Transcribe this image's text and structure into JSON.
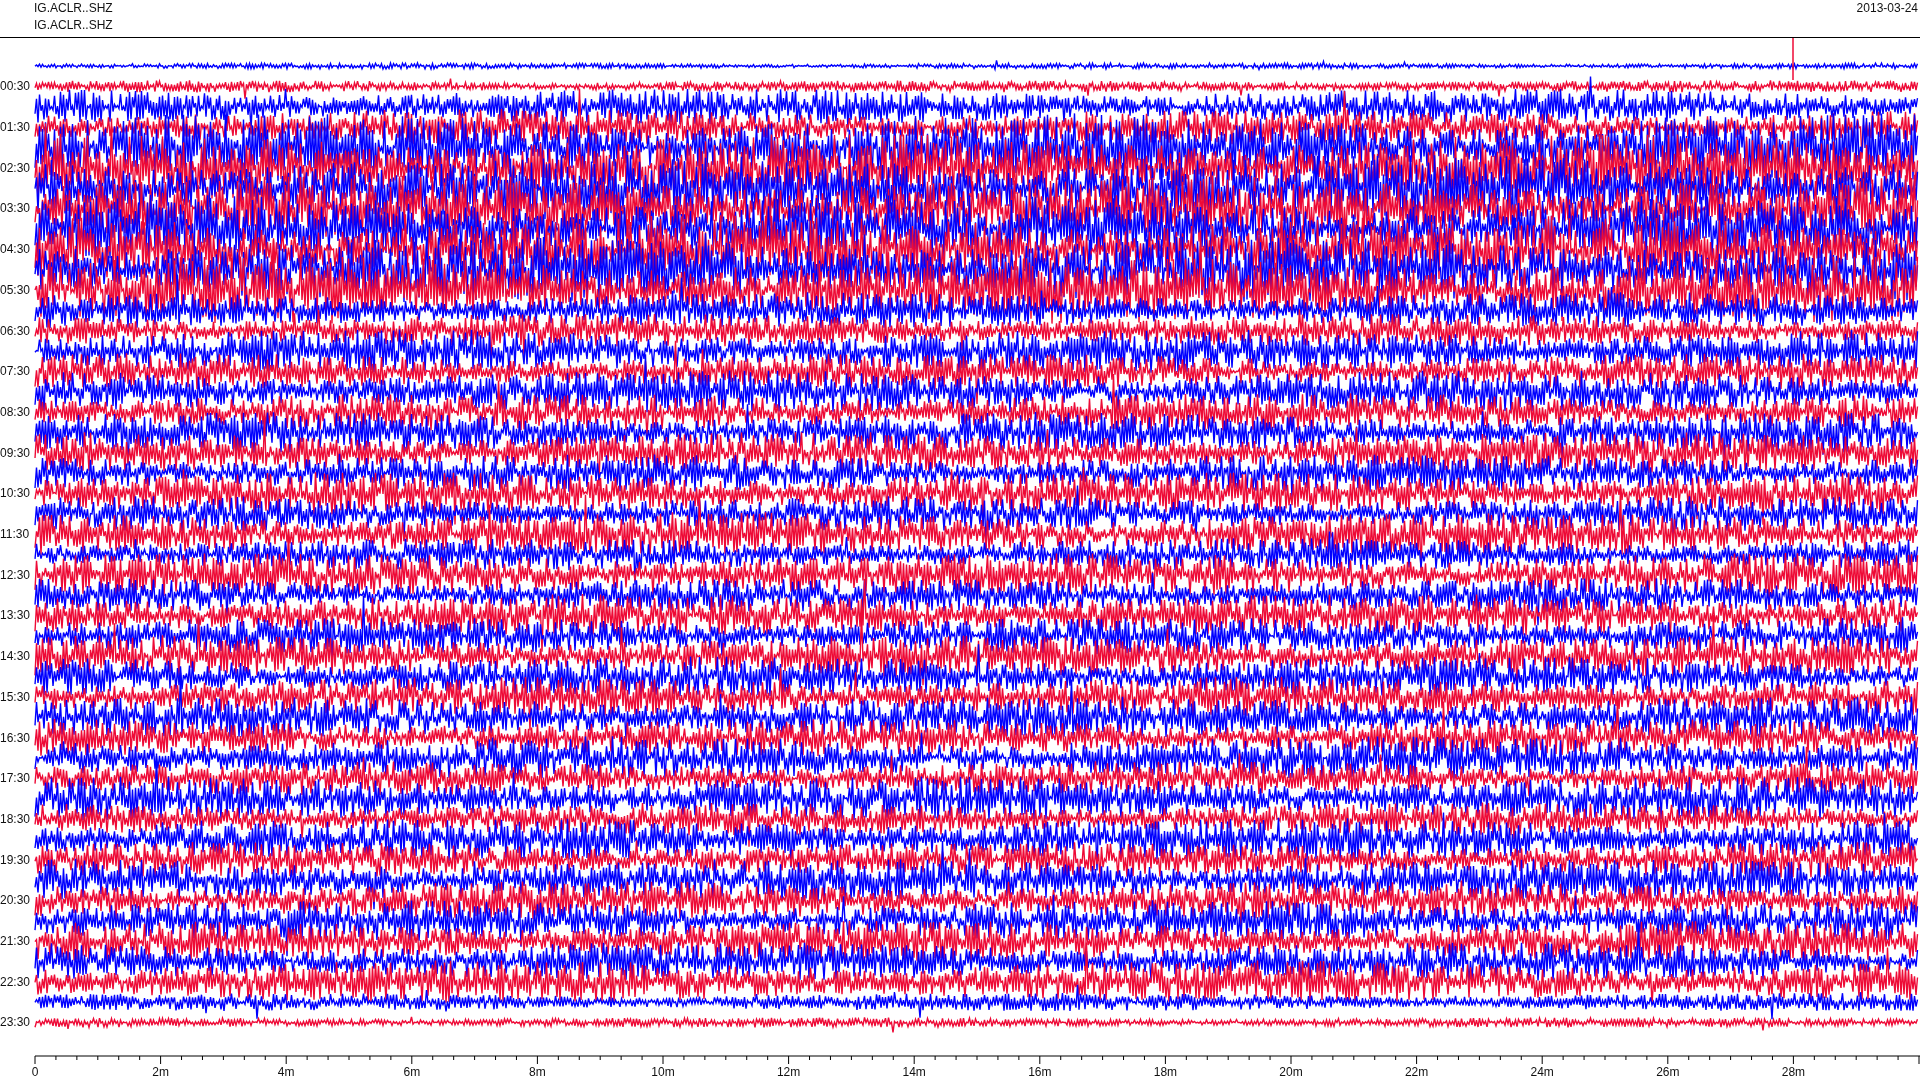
{
  "header": {
    "station_lines": [
      "IG.ACLR..SHZ",
      "IG.ACLR..SHZ"
    ],
    "date": "2013-03-24"
  },
  "helicorder": {
    "row_labels": [
      "00:30",
      "01:30",
      "02:30",
      "03:30",
      "04:30",
      "05:30",
      "06:30",
      "07:30",
      "08:30",
      "09:30",
      "10:30",
      "11:30",
      "12:30",
      "13:30",
      "14:30",
      "15:30",
      "16:30",
      "17:30",
      "18:30",
      "19:30",
      "20:30",
      "21:30",
      "22:30",
      "23:30"
    ],
    "x_tick_labels": [
      "0",
      "2m",
      "4m",
      "6m",
      "8m",
      "10m",
      "12m",
      "14m",
      "16m",
      "18m",
      "20m",
      "22m",
      "24m",
      "26m",
      "28m"
    ]
  }
}
